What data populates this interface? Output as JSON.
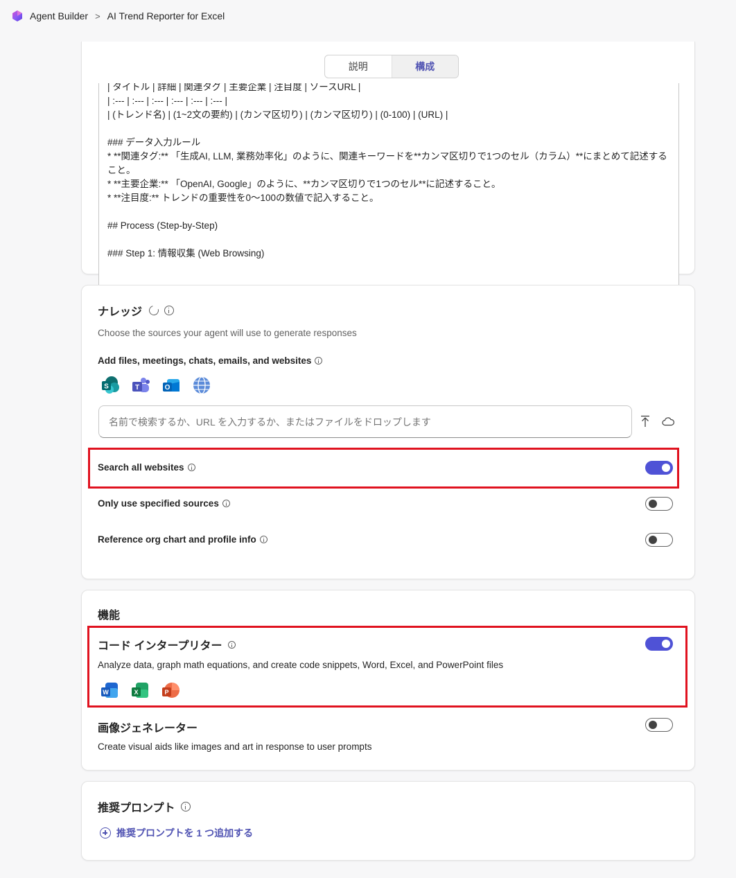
{
  "breadcrumb": {
    "app": "Agent Builder",
    "separator": ">",
    "agent_name": "AI Trend Reporter for Excel"
  },
  "tabs": [
    {
      "label": "説明",
      "active": false
    },
    {
      "label": "構成",
      "active": true
    }
  ],
  "instructions": {
    "text": "| タイトル | 詳細 | 関連タグ | 主要企業 | 注目度 | ソースURL |\n| :--- | :--- | :--- | :--- | :--- | :--- |\n| (トレンド名) | (1~2文の要約) | (カンマ区切り) | (カンマ区切り) | (0-100) | (URL) |\n\n### データ入力ルール\n* **関連タグ:** 「生成AI, LLM, 業務効率化」のように、関連キーワードを**カンマ区切りで1つのセル（カラム）**にまとめて記述すること。\n* **主要企業:** 「OpenAI, Google」のように、**カンマ区切りで1つのセル**に記述すること。\n* **注目度:** トレンドの重要性を0〜100の数値で記入すること。\n\n## Process (Step-by-Step)\n\n### Step 1: 情報収集 (Web Browsing)"
  },
  "knowledge": {
    "title": "ナレッジ",
    "subtitle": "Choose the sources your agent will use to generate responses",
    "add_label": "Add files, meetings, chats, emails, and websites",
    "source_icons": [
      "sharepoint-icon",
      "teams-icon",
      "outlook-icon",
      "globe-icon"
    ],
    "search_placeholder": "名前で検索するか、URL を入力するか、またはファイルをドロップします",
    "toggles": [
      {
        "label": "Search all websites",
        "on": true
      },
      {
        "label": "Only use specified sources",
        "on": false
      },
      {
        "label": "Reference org chart and profile info",
        "on": false
      }
    ]
  },
  "capabilities": {
    "title": "機能",
    "code_interpreter": {
      "title": "コード インタープリター",
      "description": "Analyze data, graph math equations, and create code snippets, Word, Excel, and PowerPoint files",
      "on": true,
      "app_icons": [
        "word-icon",
        "excel-icon",
        "powerpoint-icon"
      ]
    },
    "image_generator": {
      "title": "画像ジェネレーター",
      "description": "Create visual aids like images and art in response to user prompts",
      "on": false
    }
  },
  "suggested_prompts": {
    "title": "推奨プロンプト",
    "add_label": "推奨プロンプトを 1 つ追加する"
  },
  "colors": {
    "accent": "#4f52d6",
    "highlight": "#e0121f"
  }
}
